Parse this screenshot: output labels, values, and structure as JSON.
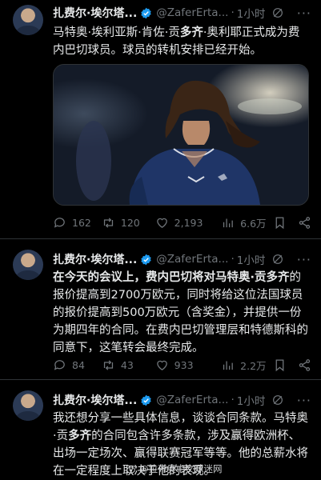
{
  "tweets": [
    {
      "name": "扎费尔·埃尔塔...",
      "handle": "@ZaferErta...",
      "dot": "·",
      "time": "1小时",
      "more": "···",
      "segments": [
        {
          "t": "马特奥·埃利亚斯·肯佐·贡",
          "b": false
        },
        {
          "t": "多齐",
          "b": true
        },
        {
          "t": "·奥利耶正式成为费内巴切球员。球员的转机安排已经开始。",
          "b": false
        }
      ],
      "has_media": true,
      "replies": "162",
      "reposts": "120",
      "likes": "2,193",
      "views": "6.6万"
    },
    {
      "name": "扎费尔·埃尔塔...",
      "handle": "@ZaferErta...",
      "dot": "·",
      "time": "1小时",
      "more": "···",
      "segments": [
        {
          "t": "在今天的会议上，费内巴切将对马特奥·贡",
          "b": true
        },
        {
          "t": "多齐",
          "b": true
        },
        {
          "t": "的报价提高到2700万欧元，同时将给这位法国球员的报价提高到500万欧元（含奖金），并提供一份为期四年的合同。在费内巴切管理层和特德斯科的同意下，这笔转会最终完成。",
          "b": false
        }
      ],
      "has_media": false,
      "replies": "84",
      "reposts": "43",
      "likes": "933",
      "views": "2.2万"
    },
    {
      "name": "扎费尔·埃尔塔...",
      "handle": "@ZaferErta...",
      "dot": "·",
      "time": "1小时",
      "more": "···",
      "segments": [
        {
          "t": "我还想分享一些具体信息，谈谈合同条款。马特奥·贡",
          "b": false
        },
        {
          "t": "多齐",
          "b": true
        },
        {
          "t": "的合同包含许多条款，涉及赢得欧洲杯、出场一定场次、赢得联赛冠军等等。他的总薪水将在一定程度上取决于他的表现。",
          "b": false
        }
      ],
      "has_media": false
    }
  ],
  "watermark": "@拉齐奥中文球迷网",
  "colors": {
    "background": "#000000",
    "text": "#e7e9ea",
    "muted": "#71767b",
    "verified": "#1d9bf0",
    "divider": "#2f3336"
  }
}
